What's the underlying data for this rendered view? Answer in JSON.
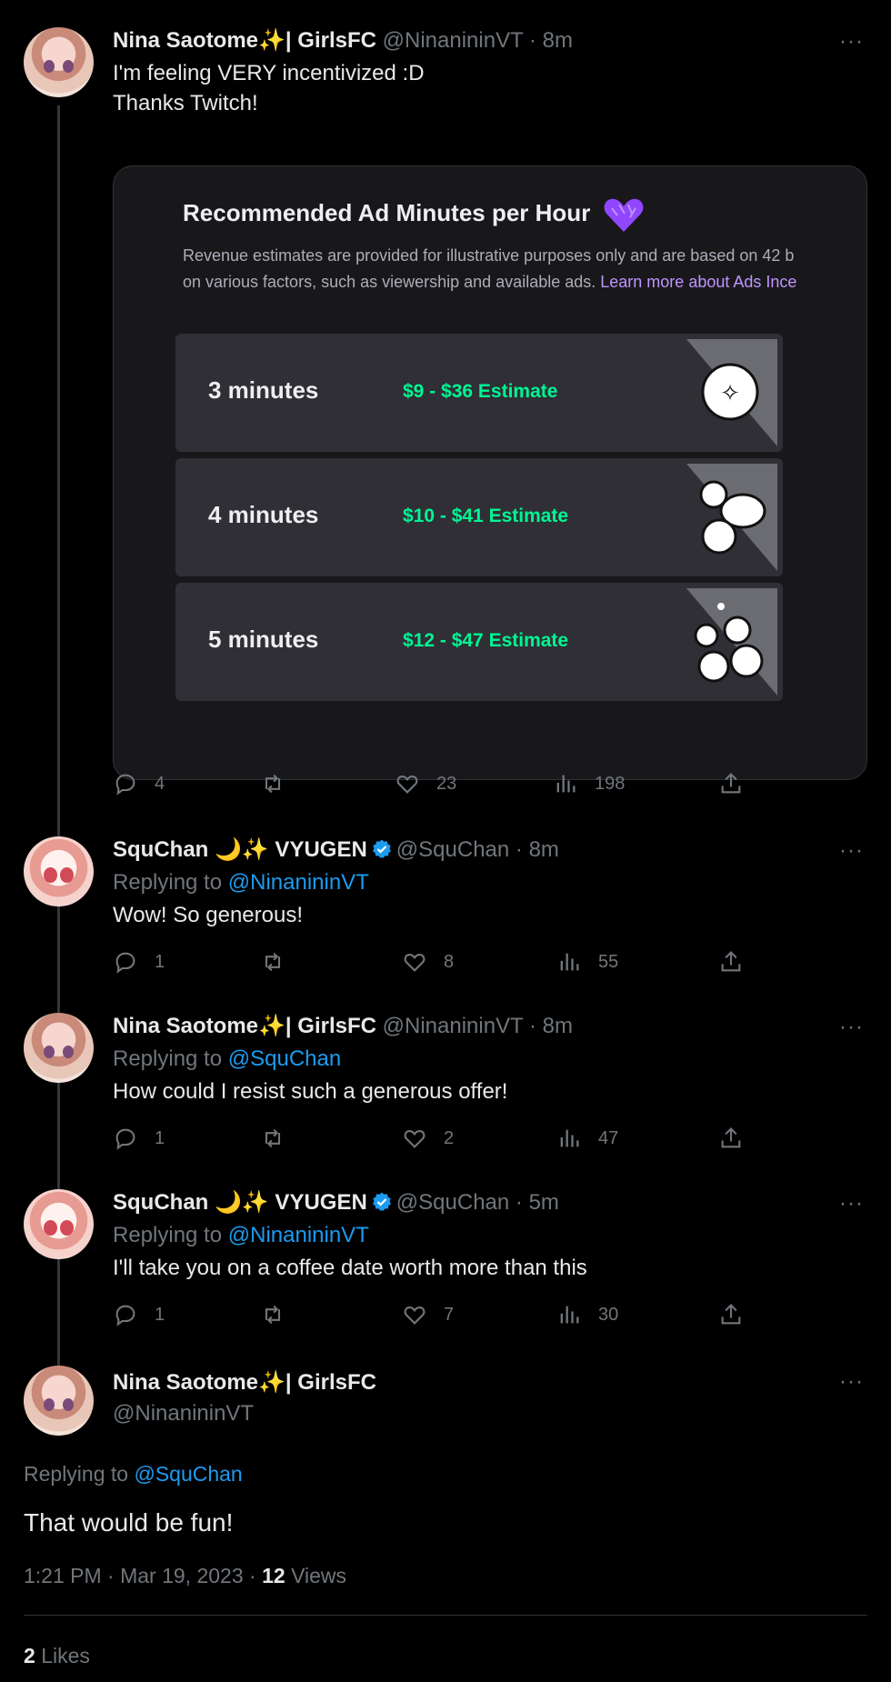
{
  "tweets": [
    {
      "name": "Nina Saotome✨| GirlsFC",
      "handle": "@NinanininVT",
      "time": "· 8m",
      "lines": [
        "I'm feeling VERY incentivized :D",
        "Thanks Twitch!"
      ],
      "stats": {
        "replies": "4",
        "retweets": "",
        "likes": "23",
        "views": "198"
      }
    },
    {
      "name": "SquChan 🌙✨ VYUGEN",
      "handle": "@SquChan",
      "time": "· 8m",
      "replying_label": "Replying to",
      "replying_to": "@NinanininVT",
      "text": "Wow! So generous!",
      "stats": {
        "replies": "1",
        "retweets": "",
        "likes": "8",
        "views": "55"
      }
    },
    {
      "name": "Nina Saotome✨| GirlsFC",
      "handle": "@NinanininVT",
      "time": "· 8m",
      "replying_label": "Replying to",
      "replying_to": "@SquChan",
      "text": "How could I resist such a generous offer!",
      "stats": {
        "replies": "1",
        "retweets": "",
        "likes": "2",
        "views": "47"
      }
    },
    {
      "name": "SquChan 🌙✨ VYUGEN",
      "handle": "@SquChan",
      "time": "· 5m",
      "replying_label": "Replying to",
      "replying_to": "@NinanininVT",
      "text": "I'll take you on a coffee date worth more than this",
      "stats": {
        "replies": "1",
        "retweets": "",
        "likes": "7",
        "views": "30"
      }
    }
  ],
  "card": {
    "title": "Recommended Ad Minutes per Hour",
    "desc_line1": "Revenue estimates are provided for illustrative purposes only and are based on 42 b",
    "desc_line2": "on various factors, such as viewership and available ads.",
    "desc_link": "Learn more about Ads Ince",
    "options": [
      {
        "minutes": "3 minutes",
        "estimate": "$9 - $36 Estimate"
      },
      {
        "minutes": "4 minutes",
        "estimate": "$10 - $41 Estimate"
      },
      {
        "minutes": "5 minutes",
        "estimate": "$12 - $47 Estimate"
      }
    ]
  },
  "main_tweet": {
    "name": "Nina Saotome✨| GirlsFC",
    "handle": "@NinanininVT",
    "replying_label": "Replying to",
    "replying_to": "@SquChan",
    "text": "That would be fun!",
    "timestamp": "1:21 PM · Mar 19, 2023 ·",
    "views_count": "12",
    "views_label": "Views",
    "likes_count": "2",
    "likes_label": "Likes"
  },
  "more_label": "···",
  "colors": {
    "accent": "#1d9bf0",
    "muted": "#71767b",
    "twitch_green": "#00f593",
    "twitch_purple": "#bf94ff"
  }
}
